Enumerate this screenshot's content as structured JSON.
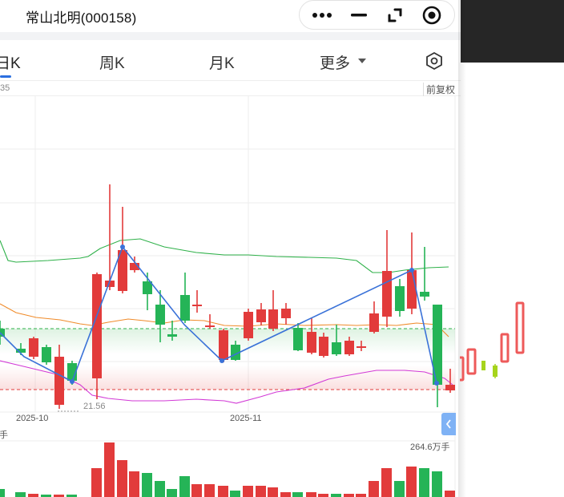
{
  "header": {
    "title": "常山北明(000158)",
    "icons": [
      "more-dots-icon",
      "minimize-icon",
      "restore-icon",
      "record-icon"
    ]
  },
  "tabs": {
    "day": "日K",
    "week": "周K",
    "month": "月K",
    "more": "更多",
    "active": "day"
  },
  "chart_info": {
    "left_value_partial": "35",
    "adjust_mode": "前复权",
    "min_price_label": "21.56",
    "x_labels": [
      "2025-10",
      "2025-11"
    ],
    "volume_unit_left": "万手",
    "volume_max_label": "264.6万手"
  },
  "colors": {
    "up": "#e23b3b",
    "down": "#25b457",
    "bollinger_upper": "#2fb14a",
    "bollinger_mid": "#f08b2a",
    "bollinger_lower": "#d23ad6",
    "zigzag": "#3a72d8",
    "accent": "#2b6fe0"
  },
  "chart_data": {
    "type": "candlestick",
    "candles": [
      {
        "dir": "down"
      },
      {
        "dir": "down"
      },
      {
        "dir": "up"
      },
      {
        "dir": "down"
      },
      {
        "dir": "up"
      },
      {
        "dir": "down"
      },
      {
        "dir": "up"
      },
      {
        "dir": "up"
      },
      {
        "dir": "up"
      },
      {
        "dir": "up"
      },
      {
        "dir": "down"
      },
      {
        "dir": "down"
      },
      {
        "dir": "down"
      },
      {
        "dir": "down"
      },
      {
        "dir": "up"
      },
      {
        "dir": "up"
      },
      {
        "dir": "up"
      },
      {
        "dir": "down"
      },
      {
        "dir": "up"
      },
      {
        "dir": "up"
      },
      {
        "dir": "up"
      },
      {
        "dir": "up"
      },
      {
        "dir": "down"
      },
      {
        "dir": "up"
      },
      {
        "dir": "up"
      },
      {
        "dir": "down"
      },
      {
        "dir": "up"
      },
      {
        "dir": "up"
      },
      {
        "dir": "up"
      },
      {
        "dir": "up"
      },
      {
        "dir": "down"
      },
      {
        "dir": "up"
      },
      {
        "dir": "down"
      },
      {
        "dir": "down"
      },
      {
        "dir": "up"
      }
    ]
  }
}
